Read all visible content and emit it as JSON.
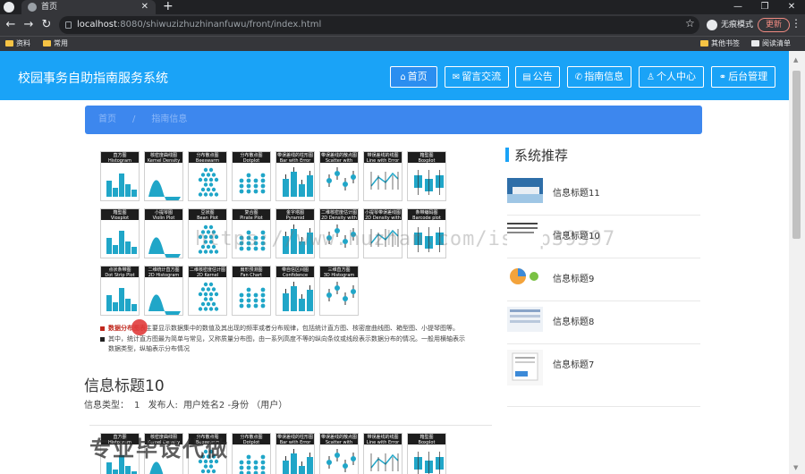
{
  "browser": {
    "tab_title": "首页",
    "url_host": "localhost",
    "url_rest": ":8080/shiwuzizhuzhinanfuwu/front/index.html",
    "profile_label": "无痕模式",
    "update_label": "更新",
    "bookmarks": [
      "资料",
      "常用"
    ],
    "bookmarks_right": [
      "其他书签",
      "阅读清单"
    ]
  },
  "header": {
    "site_title": "校园事务自助指南服务系统",
    "nav": [
      "首页",
      "留言交流",
      "公告",
      "指南信息",
      "个人中心",
      "后台管理"
    ]
  },
  "breadcrumb": {
    "home": "首页",
    "sep": "/",
    "current": "指南信息"
  },
  "gallery_tiles": [
    {
      "cn": "直方图",
      "en": "Histogram"
    },
    {
      "cn": "核密度曲线图",
      "en": "Kernel Density Estimation"
    },
    {
      "cn": "分布散点图",
      "en": "Beeswarm"
    },
    {
      "cn": "分布散点图",
      "en": "Dotplot"
    },
    {
      "cn": "带误差线的柱形图",
      "en": "Bar with Error Bar"
    },
    {
      "cn": "带误差线的散点图",
      "en": "Scatter with Error Bar"
    },
    {
      "cn": "带误差线的线图",
      "en": "Line with Error Bar"
    },
    {
      "cn": "箱型图",
      "en": "Boxplot"
    },
    {
      "cn": "箱型图",
      "en": "Vioxplot"
    },
    {
      "cn": "小提琴图",
      "en": "Violin Plot"
    },
    {
      "cn": "豆状图",
      "en": "Bean Plot"
    },
    {
      "cn": "复合图",
      "en": "Pirate Plot"
    },
    {
      "cn": "金字塔图",
      "en": "Pyramid"
    },
    {
      "cn": "二维核密度估计图",
      "en": "2D Density with Error Bar"
    },
    {
      "cn": "小提琴带误差线图",
      "en": "2D Density with Error Bar"
    },
    {
      "cn": "条带编码图",
      "en": "Barcode plot"
    },
    {
      "cn": "点状条带图",
      "en": "Dot Strip Plot"
    },
    {
      "cn": "二维统计直方图",
      "en": "2D Histogram"
    },
    {
      "cn": "二维核密度估计图",
      "en": "2D Kernel Density Estimation"
    },
    {
      "cn": "扇形预测图",
      "en": "Fan Chart"
    },
    {
      "cn": "带自信区间图",
      "en": "Confidence Interval"
    },
    {
      "cn": "三维直方图",
      "en": "3D Histogram"
    }
  ],
  "description": {
    "line1_hl": "数据分布图表",
    "line1": "主要显示数据集中的数值及其出现的频率或者分布规律，包括统计直方图、核密度曲线图、箱型图、小提琴图等。",
    "line2": "其中，统计直方图最为简单与常见，又称质量分布图，由一系列高度不等的纵向条纹或线段表示数据分布的情况。一般用横轴表示",
    "line3": "数据类型，纵轴表示分布情况"
  },
  "article": {
    "title": "信息标题10",
    "type_label": "信息类型：",
    "type_value": "1",
    "author_label": "发布人:",
    "author_value": "用户姓名2 -身份 （用户）"
  },
  "sidebar": {
    "title": "系统推荐",
    "items": [
      "信息标题11",
      "信息标题10",
      "信息标题9",
      "信息标题8",
      "信息标题7"
    ]
  },
  "watermark": "https://www.huzhan.com/ishop39397",
  "watermark2": "专业毕设代做",
  "colors": {
    "header": "#1aa3f7",
    "breadcrumb": "#3d87ee",
    "chart_teal": "#20a6c8"
  }
}
